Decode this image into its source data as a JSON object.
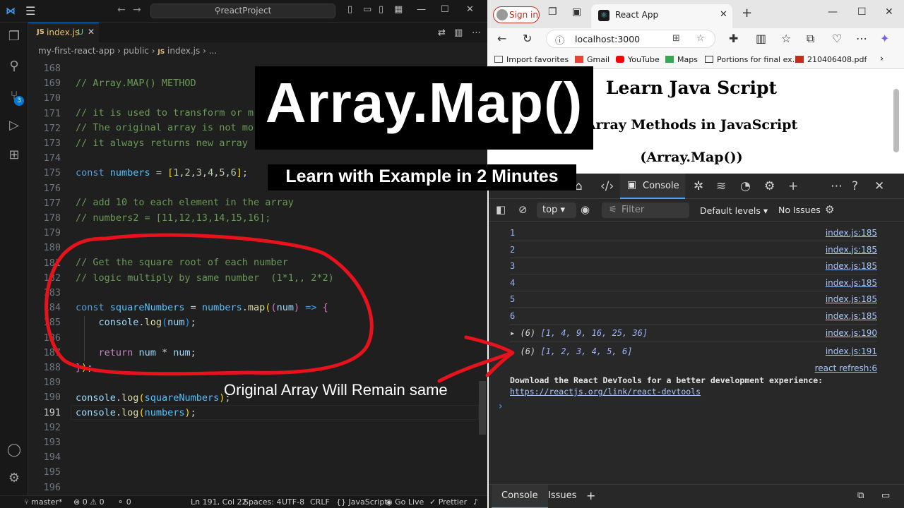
{
  "vscode": {
    "search": "reactProject",
    "tab": {
      "name": "index.js",
      "status": "U"
    },
    "breadcrumb": {
      "folder1": "my-first-react-app",
      "folder2": "public",
      "file": "index.js",
      "more": "..."
    },
    "badge_count": "3",
    "lines": [
      "168",
      "169",
      "170",
      "171",
      "172",
      "173",
      "174",
      "175",
      "176",
      "177",
      "178",
      "179",
      "180",
      "181",
      "182",
      "183",
      "184",
      "185",
      "186",
      "187",
      "188",
      "189",
      "190",
      "191",
      "192",
      "193",
      "194",
      "195",
      "196"
    ],
    "code": {
      "l169": "// Array.MAP() METHOD",
      "l171": "// it is used to transform or m",
      "l172": "// The original array is not mo",
      "l173": "// it always returns new array",
      "l177": "// add 10 to each element in the array",
      "l178": "// numbers2 = [11,12,13,14,15,16];",
      "l181": "// Get the square root of each number",
      "l182": "// logic multiply by same number  (1*1,, 2*2)"
    },
    "status": {
      "branch": "master*",
      "problems": "⊗ 0 ⚠ 0",
      "ports": "0",
      "position": "Ln 191, Col 22",
      "spaces": "Spaces: 4",
      "encoding": "UTF-8",
      "eol": "CRLF",
      "language": "JavaScript",
      "golive": "Go Live",
      "prettier": "Prettier"
    }
  },
  "browser": {
    "signin": "Sign in",
    "tab_title": "React App",
    "url": "localhost:3000",
    "favorites": [
      "Import favorites",
      "Gmail",
      "YouTube",
      "Maps",
      "Portions for final ex...",
      "210406408.pdf"
    ],
    "page": {
      "h1": "Learn Java Script",
      "h2": "Array Methods in JavaScript",
      "h3": "(Array.Map())"
    }
  },
  "devtools": {
    "console_tab": "Console",
    "context": "top",
    "filter_placeholder": "Filter",
    "levels": "Default levels",
    "issues": "No Issues",
    "rows": [
      {
        "value": "1",
        "source": "index.js:185"
      },
      {
        "value": "2",
        "source": "index.js:185"
      },
      {
        "value": "3",
        "source": "index.js:185"
      },
      {
        "value": "4",
        "source": "index.js:185"
      },
      {
        "value": "5",
        "source": "index.js:185"
      },
      {
        "value": "6",
        "source": "index.js:185"
      }
    ],
    "array1": {
      "count": "(6)",
      "items": "[1, 4, 9, 16, 25, 36]",
      "source": "index.js:190"
    },
    "array2": {
      "count": "(6)",
      "items": "[1, 2, 3, 4, 5, 6]",
      "source": "index.js:191"
    },
    "refresh_source": "react refresh:6",
    "devtools_msg": "Download the React DevTools for a better development experience:",
    "devtools_link": "https://reactjs.org/link/react-devtools",
    "drawer_tabs": [
      "Console",
      "Issues"
    ]
  },
  "overlay": {
    "title": "Array.Map()",
    "subtitle": "Learn with Example in 2 Minutes",
    "note": "Original Array Will Remain same"
  }
}
